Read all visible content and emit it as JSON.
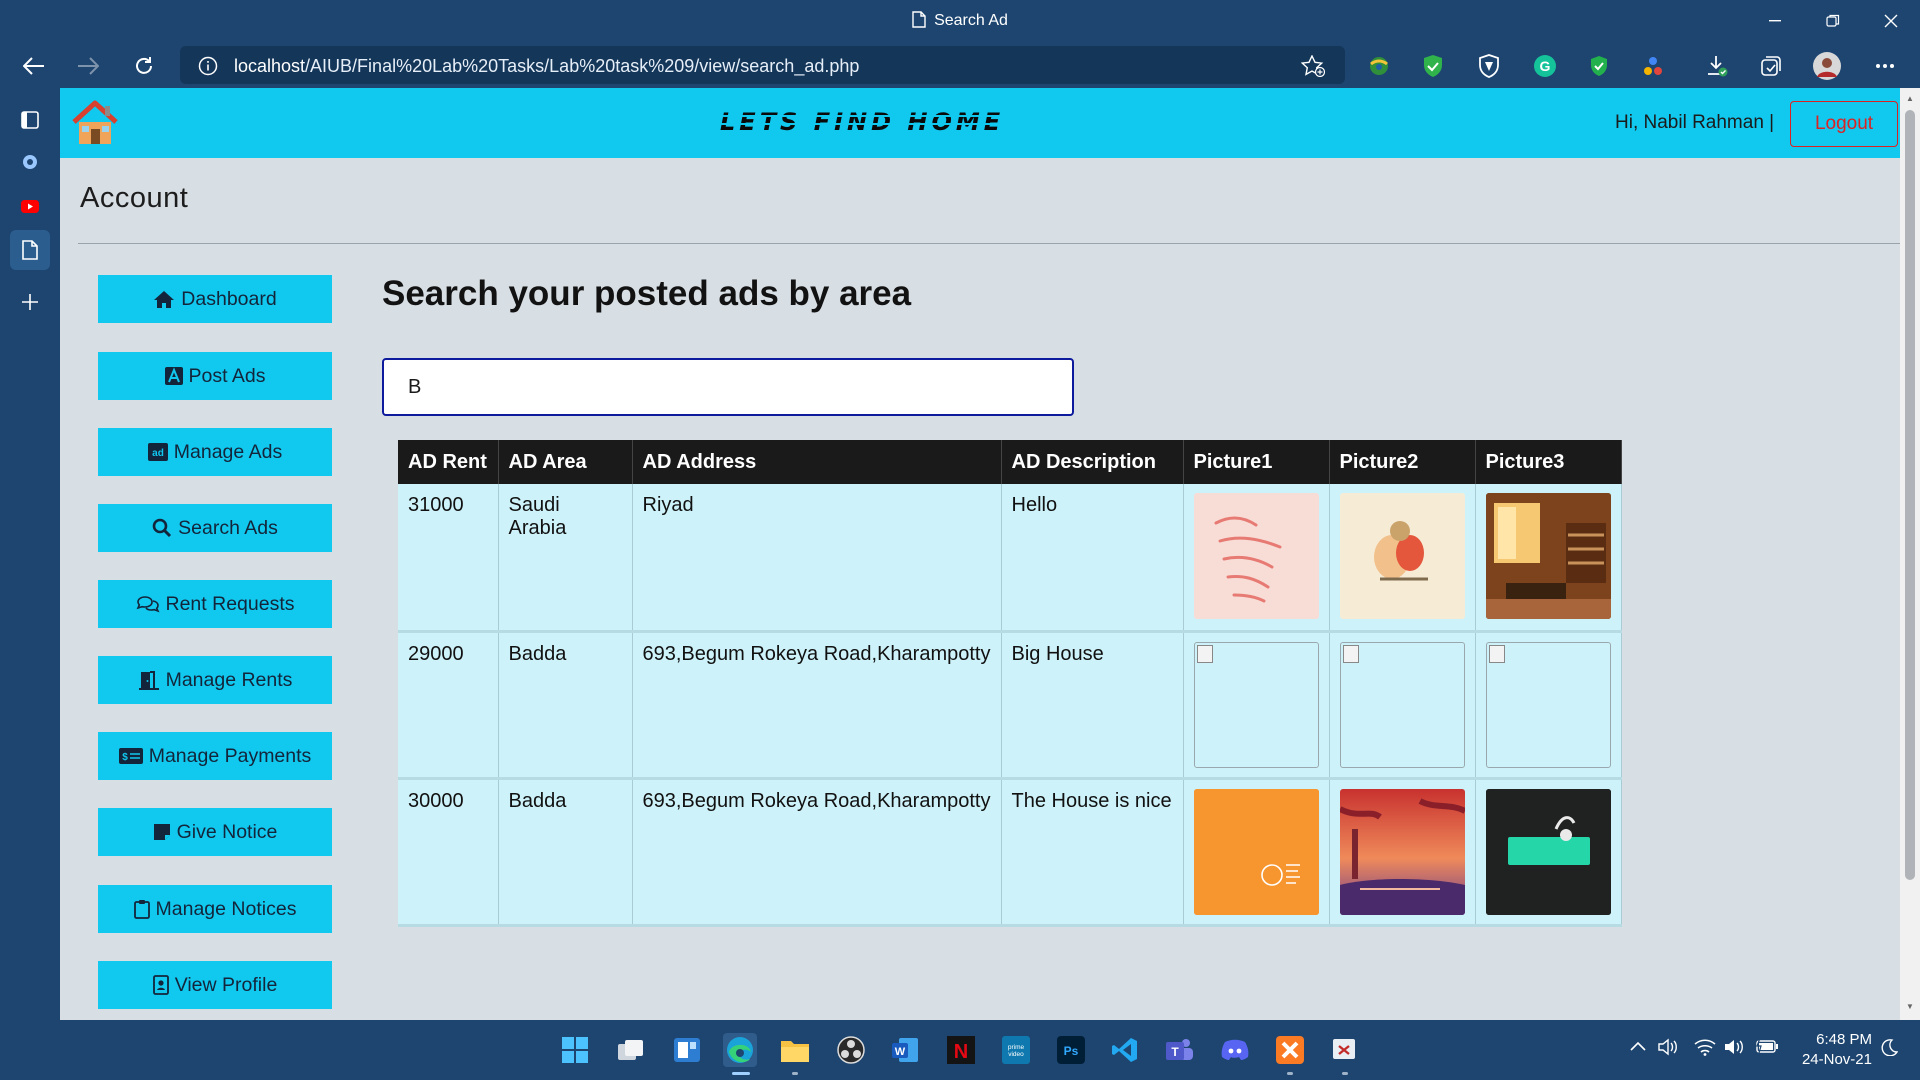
{
  "browser": {
    "tab_title": "Search Ad",
    "url_host": "localhost",
    "url_path": "/AIUB/Final%20Lab%20Tasks/Lab%20task%209/view/search_ad.php"
  },
  "header": {
    "logo_text": "LETS FIND HOME",
    "greeting": "Hi, Nabil Rahman  |",
    "logout_label": "Logout"
  },
  "page": {
    "section_title": "Account",
    "heading": "Search your posted ads by area",
    "search_value": "B"
  },
  "sidebar": {
    "items": [
      {
        "label": "Dashboard",
        "icon": "home-icon"
      },
      {
        "label": "Post Ads",
        "icon": "ad-icon"
      },
      {
        "label": "Manage Ads",
        "icon": "ad-card-icon"
      },
      {
        "label": "Search Ads",
        "icon": "search-icon"
      },
      {
        "label": "Rent Requests",
        "icon": "chat-icon"
      },
      {
        "label": "Manage Rents",
        "icon": "door-icon"
      },
      {
        "label": "Manage Payments",
        "icon": "money-icon"
      },
      {
        "label": "Give Notice",
        "icon": "note-icon"
      },
      {
        "label": "Manage Notices",
        "icon": "clipboard-icon"
      },
      {
        "label": "View Profile",
        "icon": "id-badge-icon"
      }
    ]
  },
  "table": {
    "headers": [
      "AD Rent",
      "AD Area",
      "AD Address",
      "AD Description",
      "Picture1",
      "Picture2",
      "Picture3"
    ],
    "rows": [
      {
        "rent": "31000",
        "area": "Saudi Arabia",
        "address": "Riyad",
        "description": "Hello"
      },
      {
        "rent": "29000",
        "area": "Badda",
        "address": "693,Begum Rokeya Road,Kharampotty",
        "description": "Big House"
      },
      {
        "rent": "30000",
        "area": "Badda",
        "address": "693,Begum Rokeya Road,Kharampotty",
        "description": "The House is nice"
      }
    ]
  },
  "taskbar": {
    "time": "6:48 PM",
    "date": "24-Nov-21"
  },
  "colors": {
    "header_bg": "#11c8ef",
    "page_bg": "#d7dee4",
    "table_header_bg": "#1a1a1a",
    "table_cell_bg": "#cef2f9",
    "logout": "#dd2222",
    "chrome": "#1d4570"
  }
}
